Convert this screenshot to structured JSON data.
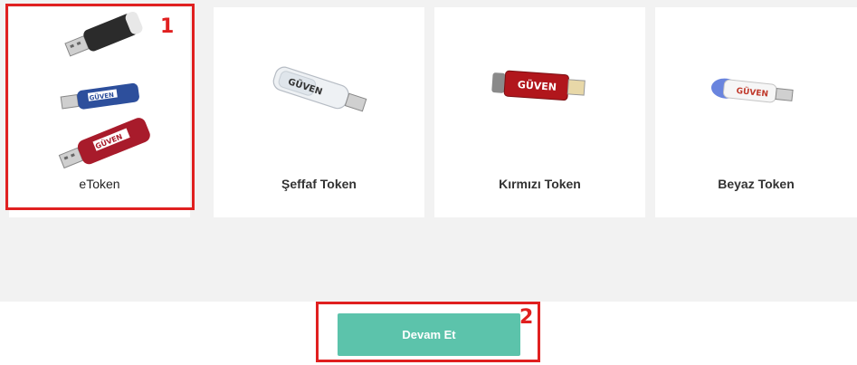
{
  "tokens": [
    {
      "label": "eToken",
      "icon": "usb-token-stack-icon"
    },
    {
      "label": "Şeffaf Token",
      "icon": "usb-token-clear-icon"
    },
    {
      "label": "Kırmızı Token",
      "icon": "usb-token-red-icon"
    },
    {
      "label": "Beyaz Token",
      "icon": "usb-token-white-icon"
    }
  ],
  "continue_button": {
    "label": "Devam Et"
  },
  "annotations": {
    "marker_1": "1",
    "marker_2": "2"
  },
  "colors": {
    "accent": "#5cc3ab",
    "marker": "#e02020",
    "panel_bg": "#f2f2f2"
  }
}
